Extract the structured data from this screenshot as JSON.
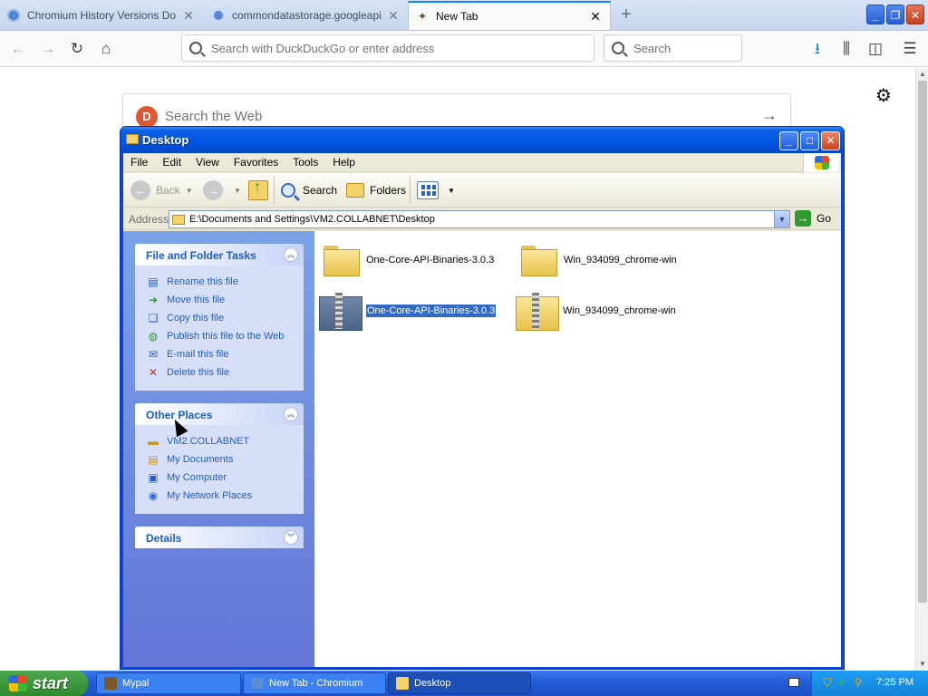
{
  "browser": {
    "tabs": [
      {
        "title": "Chromium History Versions Downl",
        "favicon": "chromium-icon",
        "active": false
      },
      {
        "title": "commondatastorage.googleapis.",
        "favicon": "storage-icon",
        "active": false
      },
      {
        "title": "New Tab",
        "favicon": "newtab-icon",
        "active": true
      }
    ],
    "url_placeholder": "Search with DuckDuckGo or enter address",
    "search_placeholder": "Search",
    "web_search_placeholder": "Search the Web"
  },
  "explorer": {
    "title": "Desktop",
    "menu": [
      "File",
      "Edit",
      "View",
      "Favorites",
      "Tools",
      "Help"
    ],
    "toolbar": {
      "back": "Back",
      "search": "Search",
      "folders": "Folders"
    },
    "address_label": "Address",
    "address_value": "E:\\Documents and Settings\\VM2.COLLABNET\\Desktop",
    "go_label": "Go",
    "file_tasks": {
      "title": "File and Folder Tasks",
      "items": [
        {
          "label": "Rename this file",
          "icon": "rename-icon"
        },
        {
          "label": "Move this file",
          "icon": "move-icon"
        },
        {
          "label": "Copy this file",
          "icon": "copy-icon"
        },
        {
          "label": "Publish this file to the Web",
          "icon": "publish-icon"
        },
        {
          "label": "E-mail this file",
          "icon": "email-icon"
        },
        {
          "label": "Delete this file",
          "icon": "delete-icon"
        }
      ]
    },
    "other_places": {
      "title": "Other Places",
      "items": [
        {
          "label": "VM2.COLLABNET",
          "icon": "folder-icon"
        },
        {
          "label": "My Documents",
          "icon": "documents-icon"
        },
        {
          "label": "My Computer",
          "icon": "computer-icon"
        },
        {
          "label": "My Network Places",
          "icon": "network-icon"
        }
      ]
    },
    "details": {
      "title": "Details"
    },
    "files": [
      {
        "name": "One-Core-API-Binaries-3.0.3",
        "type": "folder",
        "selected": false
      },
      {
        "name": "Win_934099_chrome-win",
        "type": "folder",
        "selected": false
      },
      {
        "name": "One-Core-API-Binaries-3.0.3",
        "type": "zip",
        "selected": true
      },
      {
        "name": "Win_934099_chrome-win",
        "type": "zip",
        "selected": false
      }
    ]
  },
  "taskbar": {
    "start_label": "start",
    "buttons": [
      {
        "label": "Mypal",
        "active": false
      },
      {
        "label": "New Tab - Chromium",
        "active": false
      },
      {
        "label": "Desktop",
        "active": true
      }
    ],
    "clock": "7:25 PM"
  }
}
